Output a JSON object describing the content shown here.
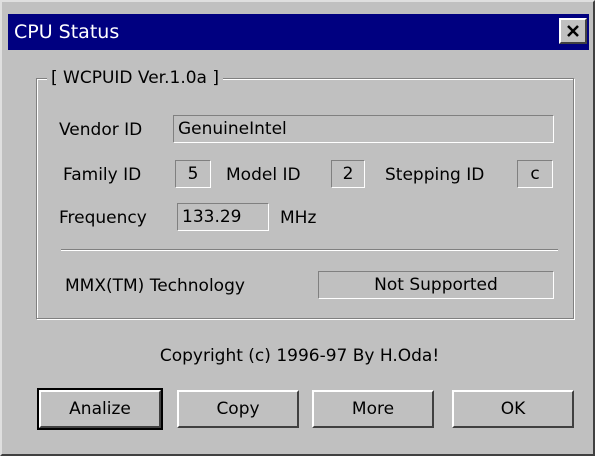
{
  "window": {
    "title": "CPU Status"
  },
  "group": {
    "legend": "[ WCPUID Ver.1.0a ]"
  },
  "vendor": {
    "label": "Vendor ID",
    "value": "GenuineIntel"
  },
  "family": {
    "label": "Family ID",
    "value": "5"
  },
  "model": {
    "label": "Model ID",
    "value": "2"
  },
  "stepping": {
    "label": "Stepping ID",
    "value": "c"
  },
  "frequency": {
    "label": "Frequency",
    "value": "133.29",
    "unit": "MHz"
  },
  "mmx": {
    "label": "MMX(TM) Technology",
    "value": "Not Supported"
  },
  "copyright": "Copyright (c) 1996-97  By H.Oda!",
  "buttons": {
    "analize": "Analize",
    "copy": "Copy",
    "more": "More",
    "ok": "OK"
  },
  "icons": {
    "close": "close-x-icon"
  },
  "colors": {
    "titlebar": "#000080",
    "face": "#c0c0c0"
  }
}
